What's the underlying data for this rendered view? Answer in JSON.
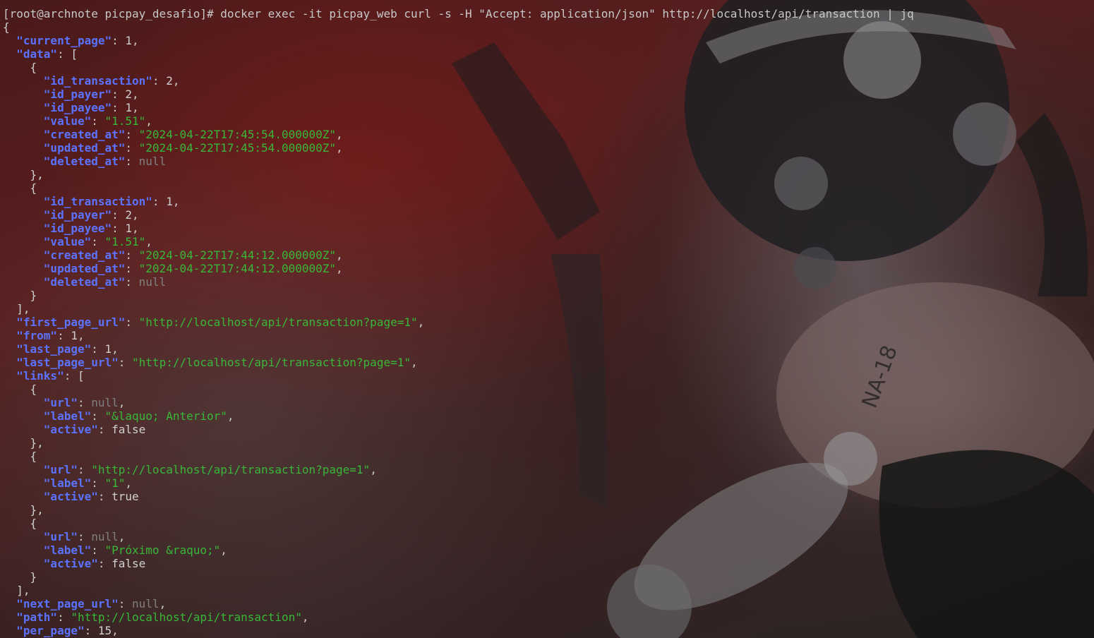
{
  "terminal": {
    "prompt": "[root@archnote picpay_desafio]# ",
    "command": "docker exec -it picpay_web curl -s -H \"Accept: application/json\" http://localhost/api/transaction | jq"
  },
  "output": [
    {
      "indent": "",
      "text": "{"
    },
    {
      "indent": "  ",
      "key": "current_page",
      "value": "1",
      "vtype": "num",
      "suffix": ","
    },
    {
      "indent": "  ",
      "key": "data",
      "value": "[",
      "vtype": "punct",
      "suffix": ""
    },
    {
      "indent": "    ",
      "text": "{"
    },
    {
      "indent": "      ",
      "key": "id_transaction",
      "value": "2",
      "vtype": "num",
      "suffix": ","
    },
    {
      "indent": "      ",
      "key": "id_payer",
      "value": "2",
      "vtype": "num",
      "suffix": ","
    },
    {
      "indent": "      ",
      "key": "id_payee",
      "value": "1",
      "vtype": "num",
      "suffix": ","
    },
    {
      "indent": "      ",
      "key": "value",
      "value": "\"1.51\"",
      "vtype": "str",
      "suffix": ","
    },
    {
      "indent": "      ",
      "key": "created_at",
      "value": "\"2024-04-22T17:45:54.000000Z\"",
      "vtype": "str",
      "suffix": ","
    },
    {
      "indent": "      ",
      "key": "updated_at",
      "value": "\"2024-04-22T17:45:54.000000Z\"",
      "vtype": "str",
      "suffix": ","
    },
    {
      "indent": "      ",
      "key": "deleted_at",
      "value": "null",
      "vtype": "null",
      "suffix": ""
    },
    {
      "indent": "    ",
      "text": "},"
    },
    {
      "indent": "    ",
      "text": "{"
    },
    {
      "indent": "      ",
      "key": "id_transaction",
      "value": "1",
      "vtype": "num",
      "suffix": ","
    },
    {
      "indent": "      ",
      "key": "id_payer",
      "value": "2",
      "vtype": "num",
      "suffix": ","
    },
    {
      "indent": "      ",
      "key": "id_payee",
      "value": "1",
      "vtype": "num",
      "suffix": ","
    },
    {
      "indent": "      ",
      "key": "value",
      "value": "\"1.51\"",
      "vtype": "str",
      "suffix": ","
    },
    {
      "indent": "      ",
      "key": "created_at",
      "value": "\"2024-04-22T17:44:12.000000Z\"",
      "vtype": "str",
      "suffix": ","
    },
    {
      "indent": "      ",
      "key": "updated_at",
      "value": "\"2024-04-22T17:44:12.000000Z\"",
      "vtype": "str",
      "suffix": ","
    },
    {
      "indent": "      ",
      "key": "deleted_at",
      "value": "null",
      "vtype": "null",
      "suffix": ""
    },
    {
      "indent": "    ",
      "text": "}"
    },
    {
      "indent": "  ",
      "text": "],"
    },
    {
      "indent": "  ",
      "key": "first_page_url",
      "value": "\"http://localhost/api/transaction?page=1\"",
      "vtype": "str",
      "suffix": ","
    },
    {
      "indent": "  ",
      "key": "from",
      "value": "1",
      "vtype": "num",
      "suffix": ","
    },
    {
      "indent": "  ",
      "key": "last_page",
      "value": "1",
      "vtype": "num",
      "suffix": ","
    },
    {
      "indent": "  ",
      "key": "last_page_url",
      "value": "\"http://localhost/api/transaction?page=1\"",
      "vtype": "str",
      "suffix": ","
    },
    {
      "indent": "  ",
      "key": "links",
      "value": "[",
      "vtype": "punct",
      "suffix": ""
    },
    {
      "indent": "    ",
      "text": "{"
    },
    {
      "indent": "      ",
      "key": "url",
      "value": "null",
      "vtype": "null",
      "suffix": ","
    },
    {
      "indent": "      ",
      "key": "label",
      "value": "\"&laquo; Anterior\"",
      "vtype": "str",
      "suffix": ","
    },
    {
      "indent": "      ",
      "key": "active",
      "value": "false",
      "vtype": "num",
      "suffix": ""
    },
    {
      "indent": "    ",
      "text": "},"
    },
    {
      "indent": "    ",
      "text": "{"
    },
    {
      "indent": "      ",
      "key": "url",
      "value": "\"http://localhost/api/transaction?page=1\"",
      "vtype": "str",
      "suffix": ","
    },
    {
      "indent": "      ",
      "key": "label",
      "value": "\"1\"",
      "vtype": "str",
      "suffix": ","
    },
    {
      "indent": "      ",
      "key": "active",
      "value": "true",
      "vtype": "num",
      "suffix": ""
    },
    {
      "indent": "    ",
      "text": "},"
    },
    {
      "indent": "    ",
      "text": "{"
    },
    {
      "indent": "      ",
      "key": "url",
      "value": "null",
      "vtype": "null",
      "suffix": ","
    },
    {
      "indent": "      ",
      "key": "label",
      "value": "\"Próximo &raquo;\"",
      "vtype": "str",
      "suffix": ","
    },
    {
      "indent": "      ",
      "key": "active",
      "value": "false",
      "vtype": "num",
      "suffix": ""
    },
    {
      "indent": "    ",
      "text": "}"
    },
    {
      "indent": "  ",
      "text": "],"
    },
    {
      "indent": "  ",
      "key": "next_page_url",
      "value": "null",
      "vtype": "null",
      "suffix": ","
    },
    {
      "indent": "  ",
      "key": "path",
      "value": "\"http://localhost/api/transaction\"",
      "vtype": "str",
      "suffix": ","
    },
    {
      "indent": "  ",
      "key": "per_page",
      "value": "15",
      "vtype": "num",
      "suffix": ","
    }
  ],
  "colors": {
    "key": "#5b73ff",
    "string": "#38b838",
    "number": "#d0d0d0",
    "null": "#808080",
    "prompt": "#c8c8c8"
  },
  "wallpaper": {
    "watermark_text": "NA-18"
  }
}
